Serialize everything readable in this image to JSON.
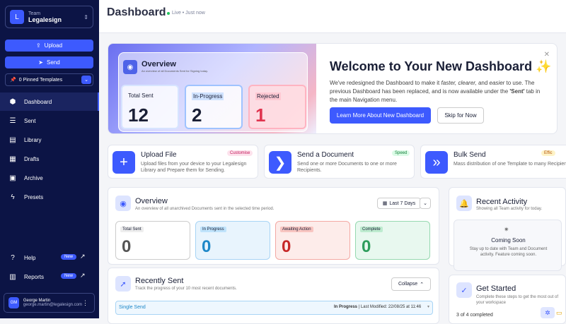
{
  "sidebar": {
    "team_label": "Team",
    "team_name": "Legalesign",
    "avatar": "L",
    "upload": "Upload",
    "send": "Send",
    "pinned": "0 Pinned Templates",
    "nav": [
      {
        "label": "Dashboard",
        "icon": "dashboard-icon"
      },
      {
        "label": "Sent",
        "icon": "list-icon"
      },
      {
        "label": "Library",
        "icon": "folder-icon"
      },
      {
        "label": "Drafts",
        "icon": "drafts-icon"
      },
      {
        "label": "Archive",
        "icon": "archive-icon"
      },
      {
        "label": "Presets",
        "icon": "bolt-icon"
      }
    ],
    "help": "Help",
    "reports": "Reports",
    "new_badge": "New",
    "user_initials": "GM",
    "user_name": "George Martin",
    "user_email": "george.martin@legalesign.com"
  },
  "header": {
    "title": "Dashboard",
    "status": "Live • Just now"
  },
  "welcome": {
    "title": "Welcome to Your New Dashboard ✨",
    "desc_1": "We've redesigned the Dashboard to make it ",
    "desc_em": "faster, clearer,",
    "desc_2": " and ",
    "desc_em2": "easier",
    "desc_3": " to use. The previous Dashboard has been replaced, and is now available under the ",
    "desc_bold": "'Sent'",
    "desc_4": " tab in the main Navigation menu.",
    "primary": "Learn More About New Dashboard",
    "secondary": "Skip for Now",
    "overview_title": "Overview",
    "overview_sub": "An overview of all Documents Sent for Signing today.",
    "cards": [
      {
        "label": "Total Sent",
        "value": "12"
      },
      {
        "label": "In-Progress",
        "value": "2"
      },
      {
        "label": "Rejected",
        "value": "1"
      }
    ]
  },
  "quick": [
    {
      "title": "Upload File",
      "desc": "Upload files from your device to your Legalesign Library and Prepare them for Sending.",
      "badge": "Customise"
    },
    {
      "title": "Send a Document",
      "desc": "Send one or more Documents to one or more Recipients.",
      "badge": "Speed"
    },
    {
      "title": "Bulk Send",
      "desc": "Mass distribution of one Template to many Recipients.",
      "badge": "Effic"
    }
  ],
  "overview": {
    "title": "Overview",
    "sub": "An overview of all unarchived Documents sent in the selected time period.",
    "range": "Last 7 Days",
    "cards": [
      {
        "label": "Total Sent",
        "value": "0"
      },
      {
        "label": "In Progress",
        "value": "0"
      },
      {
        "label": "Awaiting Action",
        "value": "0"
      },
      {
        "label": "Complete",
        "value": "0"
      }
    ]
  },
  "recent_sent": {
    "title": "Recently Sent",
    "sub": "Track the progress of your 10 most recent documents.",
    "collapse": "Collapse",
    "row_type": "Single Send",
    "row_status": "In Progress",
    "row_modified": "| Last Modified: 22/08/25 at 11:46"
  },
  "activity": {
    "title": "Recent Activity",
    "sub": "Showing all Team activity for today.",
    "soon_title": "Coming Soon",
    "soon_desc": "Stay up to date with Team and Document activity. Feature coming soon."
  },
  "started": {
    "title": "Get Started",
    "sub": "Complete these steps to get the most out of your workspace",
    "progress": "3 of 4 completed"
  }
}
